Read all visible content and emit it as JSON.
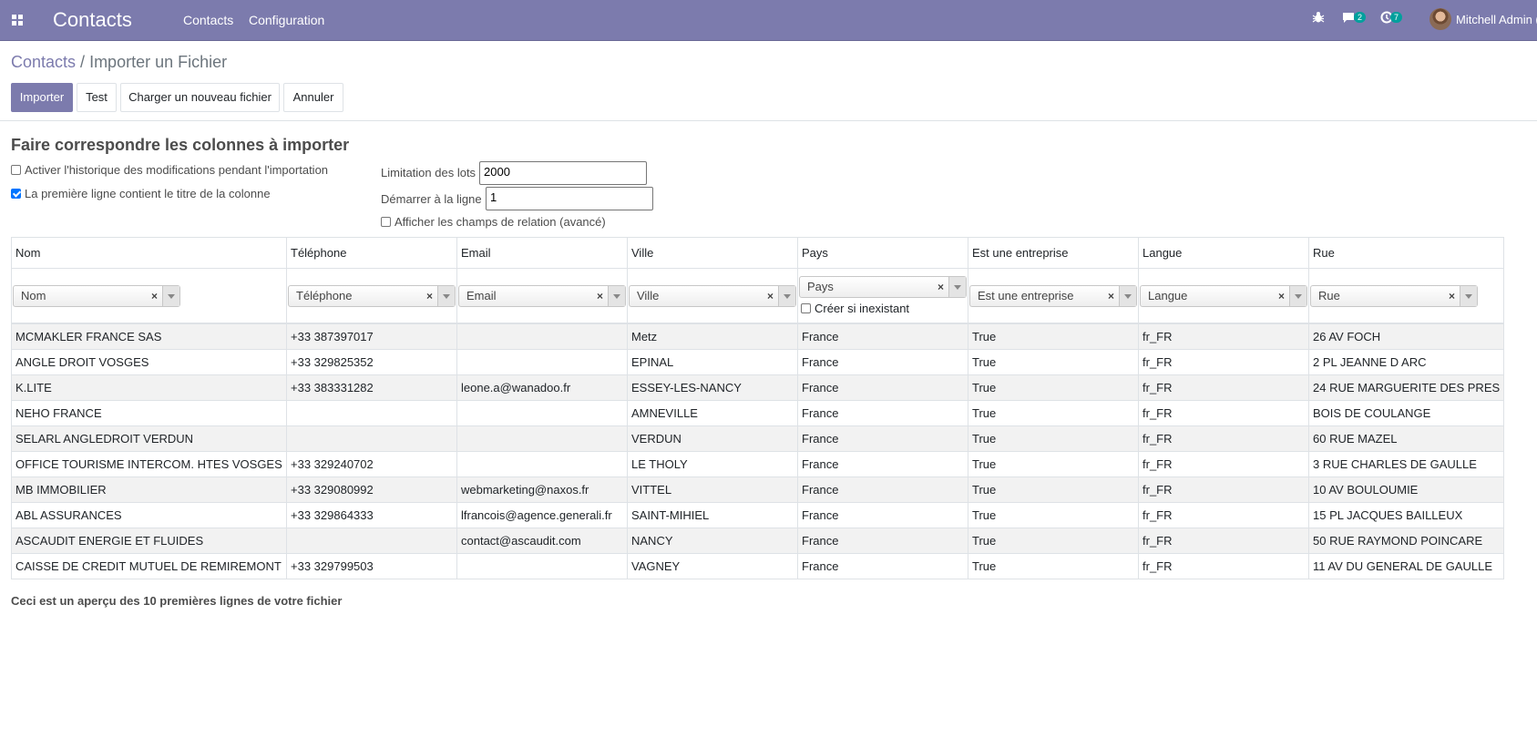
{
  "navbar": {
    "app_title": "Contacts",
    "menu": [
      "Contacts",
      "Configuration"
    ],
    "messages_count": "2",
    "activities_count": "7",
    "user_name": "Mitchell Admin ("
  },
  "breadcrumb": {
    "parent": "Contacts",
    "current": "Importer un Fichier"
  },
  "buttons": {
    "import": "Importer",
    "test": "Test",
    "load_new": "Charger un nouveau fichier",
    "cancel": "Annuler"
  },
  "options": {
    "title": "Faire correspondre les colonnes à importer",
    "track_history": {
      "label": "Activer l'historique des modifications pendant l'importation",
      "checked": false
    },
    "has_header": {
      "label": "La première ligne contient le titre de la colonne",
      "checked": true
    },
    "batch_label": "Limitation des lots",
    "batch_value": "2000",
    "start_label": "Démarrer à la ligne",
    "start_value": "1",
    "advanced": {
      "label": "Afficher les champs de relation (avancé)",
      "checked": false
    }
  },
  "table": {
    "headers": [
      "Nom",
      "Téléphone",
      "Email",
      "Ville",
      "Pays",
      "Est une entreprise",
      "Langue",
      "Rue"
    ],
    "mapping": [
      "Nom",
      "Téléphone",
      "Email",
      "Ville",
      "Pays",
      "Est une entreprise",
      "Langue",
      "Rue"
    ],
    "create_if_missing_label": "Créer si inexistant",
    "rows": [
      [
        "MCMAKLER FRANCE SAS",
        "+33 387397017",
        "",
        "Metz",
        "France",
        "True",
        "fr_FR",
        "26 AV FOCH"
      ],
      [
        "ANGLE DROIT VOSGES",
        "+33 329825352",
        "",
        "EPINAL",
        "France",
        "True",
        "fr_FR",
        "2 PL JEANNE D ARC"
      ],
      [
        "K.LITE",
        "+33 383331282",
        "leone.a@wanadoo.fr",
        "ESSEY-LES-NANCY",
        "France",
        "True",
        "fr_FR",
        "24 RUE MARGUERITE DES PRES"
      ],
      [
        "NEHO FRANCE",
        "",
        "",
        "AMNEVILLE",
        "France",
        "True",
        "fr_FR",
        "BOIS DE COULANGE"
      ],
      [
        "SELARL ANGLEDROIT VERDUN",
        "",
        "",
        "VERDUN",
        "France",
        "True",
        "fr_FR",
        "60 RUE MAZEL"
      ],
      [
        "OFFICE TOURISME INTERCOM. HTES VOSGES",
        "+33 329240702",
        "",
        "LE THOLY",
        "France",
        "True",
        "fr_FR",
        "3 RUE CHARLES DE GAULLE"
      ],
      [
        "MB IMMOBILIER",
        "+33 329080992",
        "webmarketing@naxos.fr",
        "VITTEL",
        "France",
        "True",
        "fr_FR",
        "10 AV BOULOUMIE"
      ],
      [
        "ABL ASSURANCES",
        "+33 329864333",
        "lfrancois@agence.generali.fr",
        "SAINT-MIHIEL",
        "France",
        "True",
        "fr_FR",
        "15 PL JACQUES BAILLEUX"
      ],
      [
        "ASCAUDIT ENERGIE ET FLUIDES",
        "",
        "contact@ascaudit.com",
        "NANCY",
        "France",
        "True",
        "fr_FR",
        "50 RUE RAYMOND POINCARE"
      ],
      [
        "CAISSE DE CREDIT MUTUEL DE REMIREMONT",
        "+33 329799503",
        "",
        "VAGNEY",
        "France",
        "True",
        "fr_FR",
        "11 AV DU GENERAL DE GAULLE"
      ]
    ]
  },
  "footnote": "Ceci est un aperçu des 10 premières lignes de votre fichier"
}
